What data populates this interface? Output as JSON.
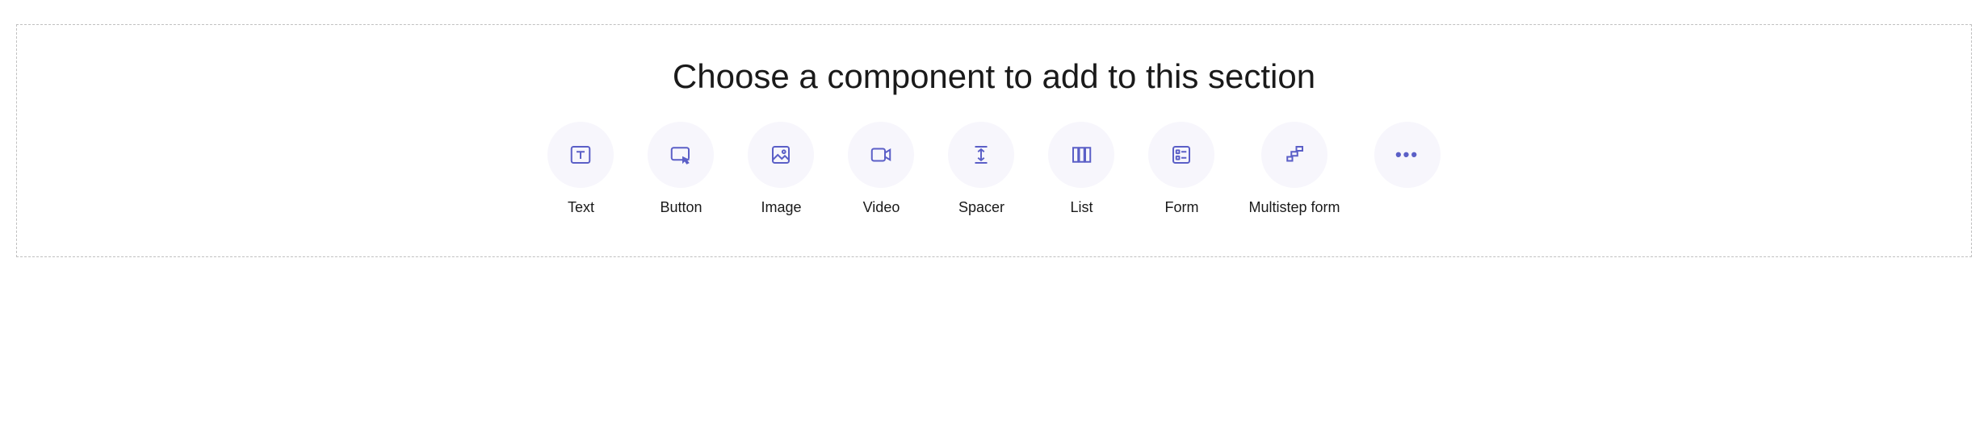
{
  "section": {
    "title": "Choose a component to add to this section"
  },
  "components": {
    "text": {
      "label": "Text"
    },
    "button": {
      "label": "Button"
    },
    "image": {
      "label": "Image"
    },
    "video": {
      "label": "Video"
    },
    "spacer": {
      "label": "Spacer"
    },
    "list": {
      "label": "List"
    },
    "form": {
      "label": "Form"
    },
    "multistep": {
      "label": "Multistep form"
    }
  },
  "colors": {
    "accent": "#5b5fc7",
    "iconBg": "#f7f6fc",
    "border": "#c0c0c0"
  }
}
